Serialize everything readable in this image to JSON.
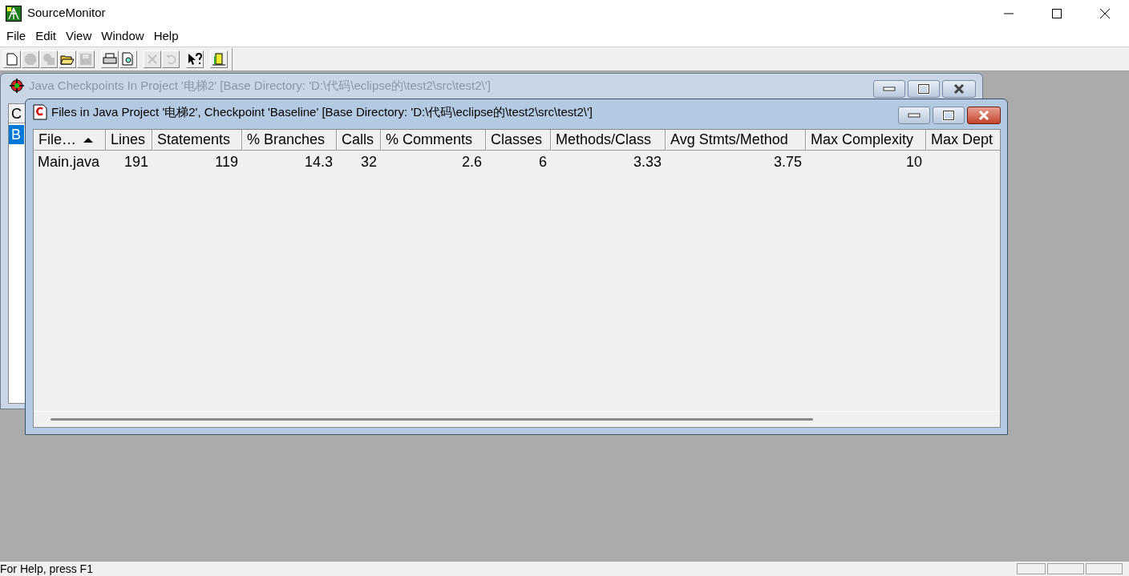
{
  "app": {
    "title": "SourceMonitor"
  },
  "menu": [
    "File",
    "Edit",
    "View",
    "Window",
    "Help"
  ],
  "toolbar": [
    {
      "kind": "new",
      "disabled": false
    },
    {
      "kind": "circle",
      "disabled": true
    },
    {
      "kind": "shapes",
      "disabled": true
    },
    {
      "kind": "open",
      "disabled": false
    },
    {
      "kind": "save",
      "disabled": true
    },
    {
      "kind": "sep"
    },
    {
      "kind": "print",
      "disabled": false
    },
    {
      "kind": "preview",
      "disabled": false
    },
    {
      "kind": "sep"
    },
    {
      "kind": "delete",
      "disabled": true
    },
    {
      "kind": "undo",
      "disabled": true
    },
    {
      "kind": "sep"
    },
    {
      "kind": "help",
      "disabled": false
    },
    {
      "kind": "sep"
    },
    {
      "kind": "exit",
      "disabled": false
    }
  ],
  "checkpoints_window": {
    "title": "Java Checkpoints In Project '电梯2'  [Base Directory: 'D:\\代码\\eclipse的\\test2\\src\\test2\\']",
    "column_header": "C",
    "rows": [
      {
        "text": "B",
        "selected": true
      }
    ]
  },
  "files_window": {
    "title": "Files in Java Project '电梯2', Checkpoint 'Baseline'  [Base Directory: 'D:\\代码\\eclipse的\\test2\\src\\test2\\']",
    "columns": [
      {
        "label": "File…",
        "sorted": true
      },
      {
        "label": "Lines",
        "sorted": false
      },
      {
        "label": "Statements",
        "sorted": false
      },
      {
        "label": "% Branches",
        "sorted": false
      },
      {
        "label": "Calls",
        "sorted": false
      },
      {
        "label": "% Comments",
        "sorted": false
      },
      {
        "label": "Classes",
        "sorted": false
      },
      {
        "label": "Methods/Class",
        "sorted": false
      },
      {
        "label": "Avg Stmts/Method",
        "sorted": false
      },
      {
        "label": "Max Complexity",
        "sorted": false
      },
      {
        "label": "Max Dept",
        "sorted": false
      }
    ],
    "rows": [
      {
        "cells": [
          "Main.java",
          "191",
          "119",
          "14.3",
          "32",
          "2.6",
          "6",
          "3.33",
          "3.75",
          "10"
        ]
      }
    ]
  },
  "status_bar": {
    "text": "For Help, press F1"
  }
}
